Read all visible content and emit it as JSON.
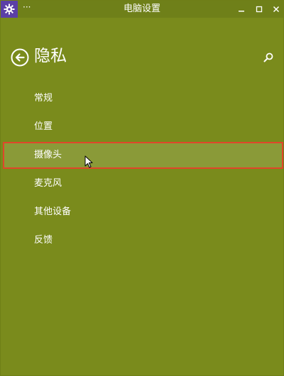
{
  "window": {
    "title": "电脑设置",
    "menu_glyph": "···",
    "controls": {
      "minimize": "—",
      "maximize": "□",
      "close": "✕"
    },
    "icon": "gear-icon",
    "icon_color": "#5b3fa6",
    "accent": "#7a8b1c"
  },
  "header": {
    "title": "隐私",
    "back_icon": "back-arrow-icon",
    "search_icon": "search-icon"
  },
  "nav": {
    "selected_index": 2,
    "highlight_border": "#e0462a",
    "items": [
      {
        "label": "常规"
      },
      {
        "label": "位置"
      },
      {
        "label": "摄像头"
      },
      {
        "label": "麦克风"
      },
      {
        "label": "其他设备"
      },
      {
        "label": "反馈"
      }
    ]
  }
}
